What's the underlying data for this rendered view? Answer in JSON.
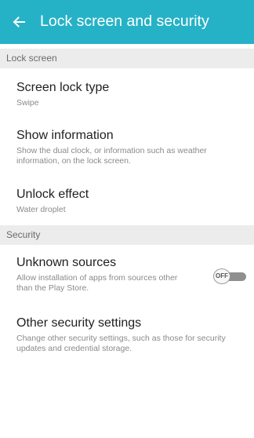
{
  "header": {
    "title": "Lock screen and security",
    "back_icon": "arrow-left-icon"
  },
  "sections": {
    "lock_screen": {
      "label": "Lock screen",
      "items": [
        {
          "title": "Screen lock type",
          "subtitle": "Swipe"
        },
        {
          "title": "Show information",
          "subtitle": "Show the dual clock, or information such as weather information, on the lock screen."
        },
        {
          "title": "Unlock effect",
          "subtitle": "Water droplet"
        }
      ]
    },
    "security": {
      "label": "Security",
      "items": [
        {
          "title": "Unknown sources",
          "subtitle": "Allow installation of apps from sources other than the Play Store.",
          "toggle_label": "OFF"
        },
        {
          "title": "Other security settings",
          "subtitle": "Change other security settings, such as those for security updates and credential storage."
        }
      ]
    }
  },
  "colors": {
    "app_bar": "#26b2c6",
    "section_header_bg": "#ececec"
  }
}
